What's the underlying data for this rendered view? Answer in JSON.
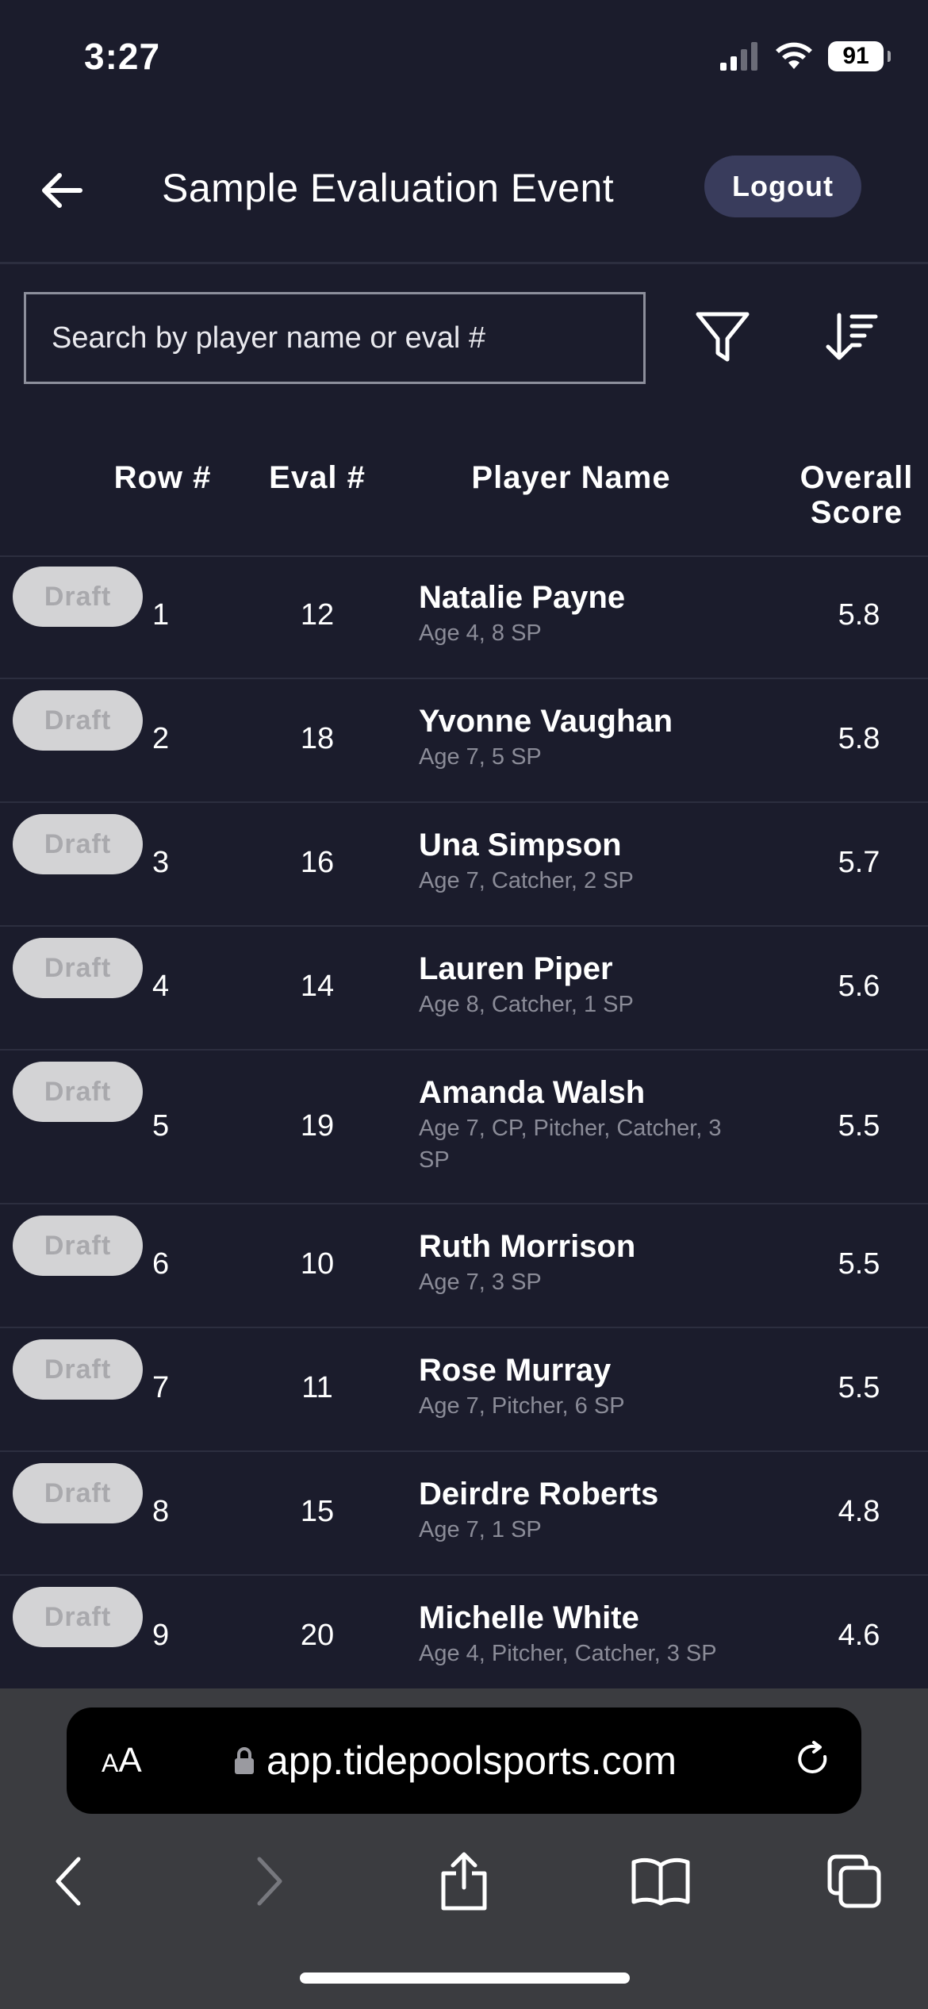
{
  "status": {
    "time": "3:27",
    "battery": "91"
  },
  "header": {
    "title": "Sample Evaluation Event",
    "logout_label": "Logout"
  },
  "search": {
    "placeholder": "Search by player name or eval #"
  },
  "table": {
    "columns": {
      "row": "Row #",
      "eval": "Eval #",
      "name": "Player Name",
      "score_line1": "Overall",
      "score_line2": "Score"
    },
    "draft_label": "Draft",
    "rows": [
      {
        "row": "1",
        "eval": "12",
        "name": "Natalie Payne",
        "desc": "Age 4, 8 SP",
        "score": "5.8"
      },
      {
        "row": "2",
        "eval": "18",
        "name": "Yvonne Vaughan",
        "desc": "Age 7, 5 SP",
        "score": "5.8"
      },
      {
        "row": "3",
        "eval": "16",
        "name": "Una Simpson",
        "desc": "Age 7, Catcher, 2 SP",
        "score": "5.7"
      },
      {
        "row": "4",
        "eval": "14",
        "name": "Lauren Piper",
        "desc": "Age 8, Catcher, 1 SP",
        "score": "5.6"
      },
      {
        "row": "5",
        "eval": "19",
        "name": "Amanda Walsh",
        "desc": "Age 7, CP, Pitcher, Catcher, 3 SP",
        "score": "5.5"
      },
      {
        "row": "6",
        "eval": "10",
        "name": "Ruth Morrison",
        "desc": "Age 7, 3 SP",
        "score": "5.5"
      },
      {
        "row": "7",
        "eval": "11",
        "name": "Rose Murray",
        "desc": "Age 7, Pitcher, 6 SP",
        "score": "5.5"
      },
      {
        "row": "8",
        "eval": "15",
        "name": "Deirdre Roberts",
        "desc": "Age 7, 1 SP",
        "score": "4.8"
      },
      {
        "row": "9",
        "eval": "20",
        "name": "Michelle White",
        "desc": "Age 4, Pitcher, Catcher, 3 SP",
        "score": "4.6"
      }
    ]
  },
  "browser": {
    "aa_small": "A",
    "aa_large": "A",
    "url": "app.tidepoolsports.com"
  },
  "icons": {
    "back": "arrow-left-icon",
    "filter": "filter-icon",
    "sort": "sort-descending-icon",
    "lock": "lock-icon",
    "reload": "reload-icon",
    "nav_back": "chevron-left-icon",
    "nav_forward": "chevron-right-icon",
    "share": "share-icon",
    "bookmarks": "book-icon",
    "tabs": "tabs-icon"
  },
  "colors": {
    "background": "#1b1c2c",
    "logout_bg": "#393c5c",
    "draft_bg": "#d3d3d5",
    "browser_bg": "#3b3c40"
  }
}
